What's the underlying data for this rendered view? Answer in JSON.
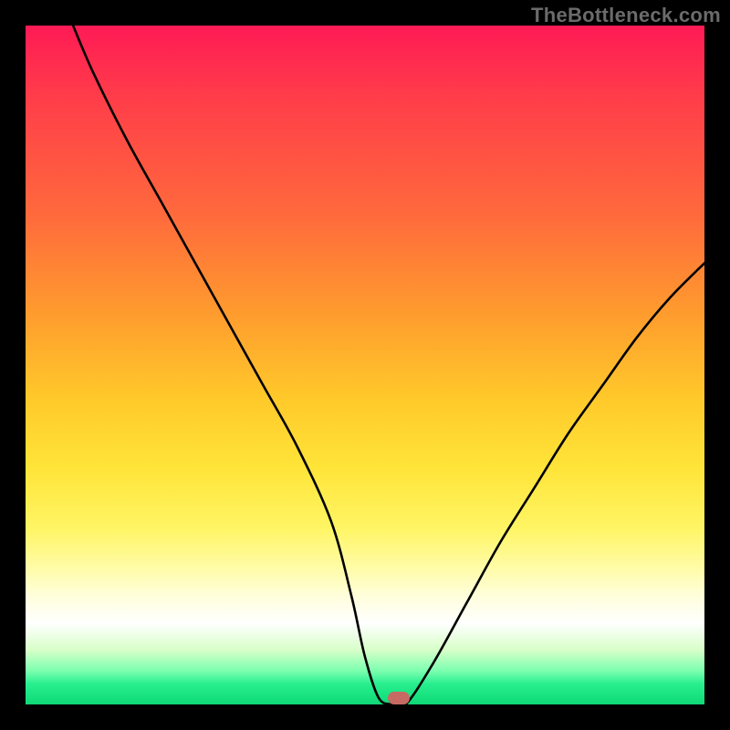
{
  "watermark": "TheBottleneck.com",
  "chart_data": {
    "type": "line",
    "title": "",
    "xlabel": "",
    "ylabel": "",
    "xlim": [
      0,
      100
    ],
    "ylim": [
      0,
      100
    ],
    "grid": false,
    "series": [
      {
        "name": "bottleneck-curve",
        "x": [
          7,
          10,
          15,
          20,
          25,
          30,
          35,
          40,
          45,
          48,
          50,
          52,
          54,
          56,
          60,
          65,
          70,
          75,
          80,
          85,
          90,
          95,
          100
        ],
        "y": [
          100,
          93,
          83,
          74,
          65,
          56,
          47,
          38,
          27,
          16,
          7,
          1,
          0,
          0,
          6,
          15,
          24,
          32,
          40,
          47,
          54,
          60,
          65
        ]
      }
    ],
    "annotations": [
      {
        "name": "optimum-marker",
        "x": 55,
        "y": 1
      }
    ],
    "background_gradient": {
      "stops": [
        {
          "pos": 0,
          "color": "#ff1a55"
        },
        {
          "pos": 28,
          "color": "#ff6a3c"
        },
        {
          "pos": 55,
          "color": "#ffc92a"
        },
        {
          "pos": 80,
          "color": "#fffca8"
        },
        {
          "pos": 88,
          "color": "#ffffff"
        },
        {
          "pos": 100,
          "color": "#0fd877"
        }
      ]
    }
  }
}
